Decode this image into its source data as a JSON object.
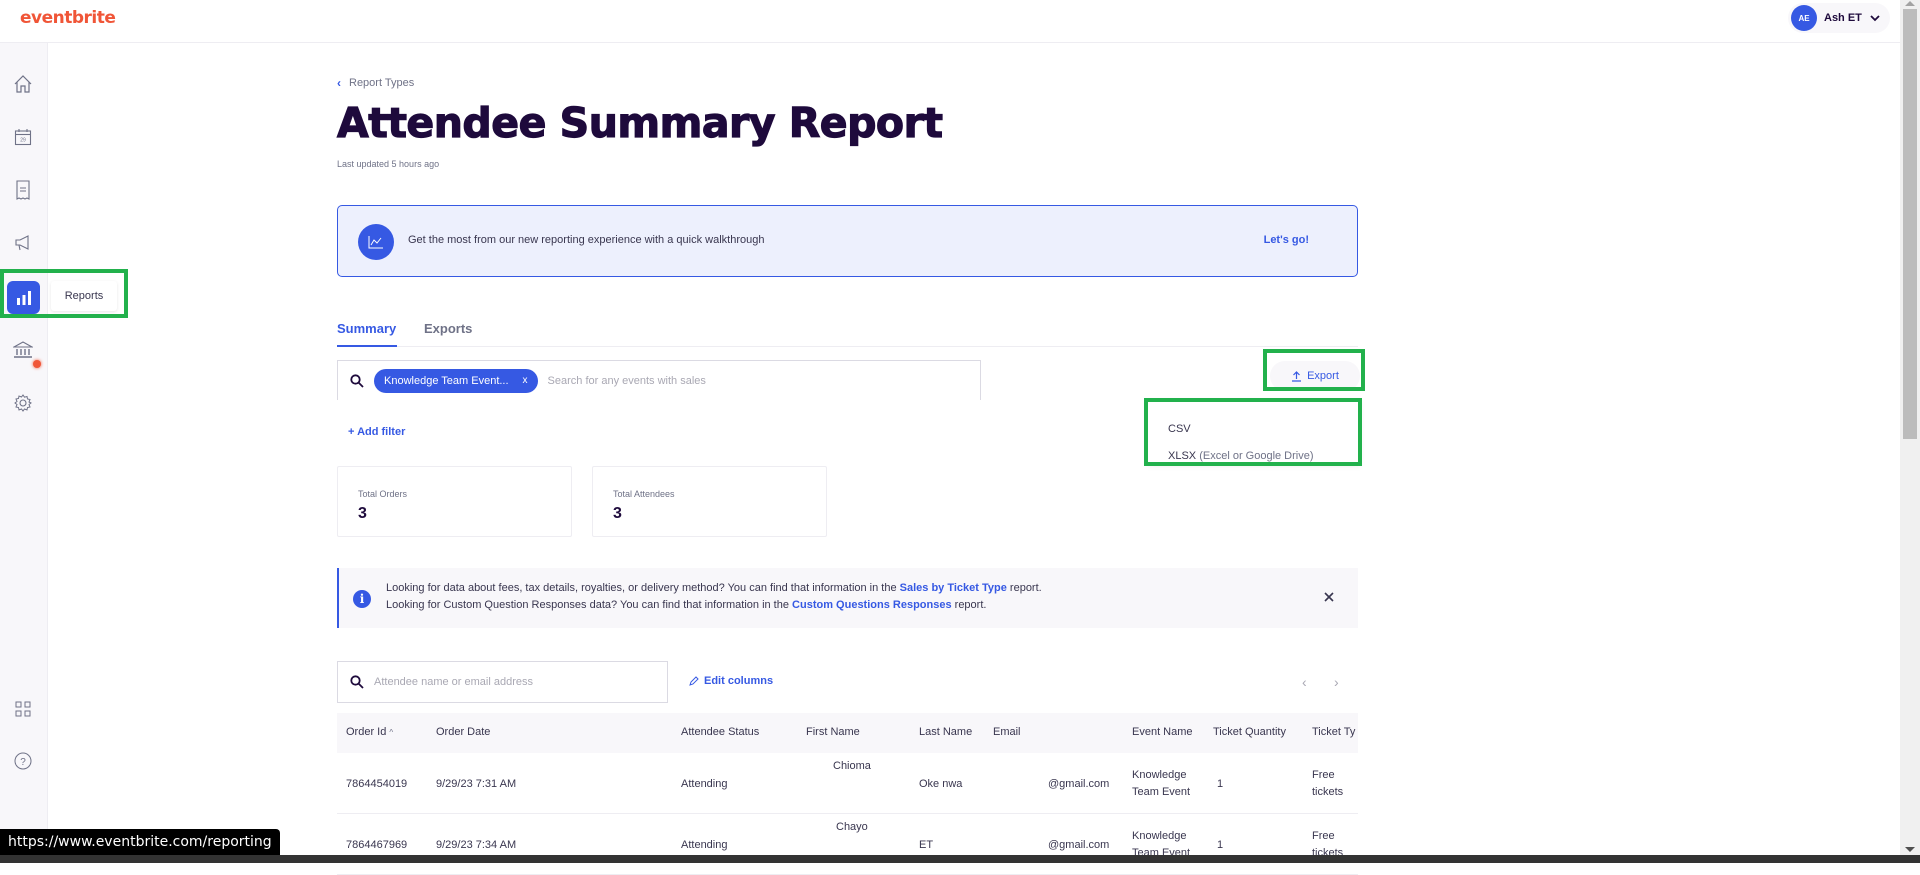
{
  "app": {
    "logo": "eventbrite"
  },
  "user": {
    "initials": "AE",
    "name": "Ash ET"
  },
  "sidebar": {
    "items": [
      {
        "name": "home",
        "icon": "home-icon"
      },
      {
        "name": "events",
        "icon": "calendar-icon",
        "date_label": "29"
      },
      {
        "name": "orders",
        "icon": "receipt-icon"
      },
      {
        "name": "marketing",
        "icon": "megaphone-icon"
      },
      {
        "name": "reports",
        "icon": "bar-chart-icon",
        "active": true,
        "tooltip": "Reports"
      },
      {
        "name": "finance",
        "icon": "bank-icon",
        "badge": true
      },
      {
        "name": "settings",
        "icon": "gear-icon"
      },
      {
        "name": "apps",
        "icon": "grid-icon"
      },
      {
        "name": "help",
        "icon": "help-icon"
      }
    ]
  },
  "page": {
    "breadcrumb": "Report Types",
    "title": "Attendee Summary Report",
    "last_updated": "Last updated 5 hours ago"
  },
  "walkthrough": {
    "text": "Get the most from our new reporting experience with a quick walkthrough",
    "link": "Let's go!"
  },
  "tabs": [
    {
      "label": "Summary",
      "active": true
    },
    {
      "label": "Exports",
      "active": false
    }
  ],
  "event_search": {
    "chip": "Knowledge Team Event...",
    "chip_close": "x",
    "placeholder": "Search for any events with sales"
  },
  "add_filter": "Add filter",
  "stats": [
    {
      "label": "Total Orders",
      "value": "3"
    },
    {
      "label": "Total Attendees",
      "value": "3"
    }
  ],
  "info_banner": {
    "line1_pre": "Looking for data about fees, tax details, royalties, or delivery method? You can find that information in the ",
    "line1_link": "Sales by Ticket Type",
    "line1_post": " report.",
    "line2_pre": "Looking for Custom Question Responses data? You can find that information in the ",
    "line2_link": "Custom Questions Responses",
    "line2_post": " report."
  },
  "export": {
    "button": "Export",
    "menu": [
      {
        "label": "CSV",
        "note": ""
      },
      {
        "label": "XLSX",
        "note": "(Excel or Google Drive)"
      }
    ]
  },
  "attendee_search": {
    "placeholder": "Attendee name or email address"
  },
  "edit_columns": "Edit columns",
  "table": {
    "columns": [
      "Order Id",
      "Order Date",
      "Attendee Status",
      "First Name",
      "Last Name",
      "Email",
      "Event Name",
      "Ticket Quantity",
      "Ticket Ty"
    ],
    "sort_indicator": "^",
    "rows": [
      {
        "order_id": "7864454019",
        "order_date": "9/29/23 7:31 AM",
        "status": "Attending",
        "first_name": "Chioma",
        "last_name": "Oke nwa",
        "email": "@gmail.com",
        "event_name_1": "Knowledge",
        "event_name_2": "Team Event",
        "qty": "1",
        "ticket_1": "Free",
        "ticket_2": "tickets"
      },
      {
        "order_id": "7864467969",
        "order_date": "9/29/23 7:34 AM",
        "status": "Attending",
        "first_name": "Chayo",
        "last_name": "ET",
        "email": "@gmail.com",
        "event_name_1": "Knowledge",
        "event_name_2": "Team Event",
        "qty": "1",
        "ticket_1": "Free",
        "ticket_2": "tickets"
      }
    ]
  },
  "status_bar": {
    "url": "https://www.eventbrite.com/reporting"
  },
  "colors": {
    "brand": "#f05537",
    "accent": "#3659e3",
    "highlight": "#22b14c",
    "title": "#1e0a3c"
  }
}
